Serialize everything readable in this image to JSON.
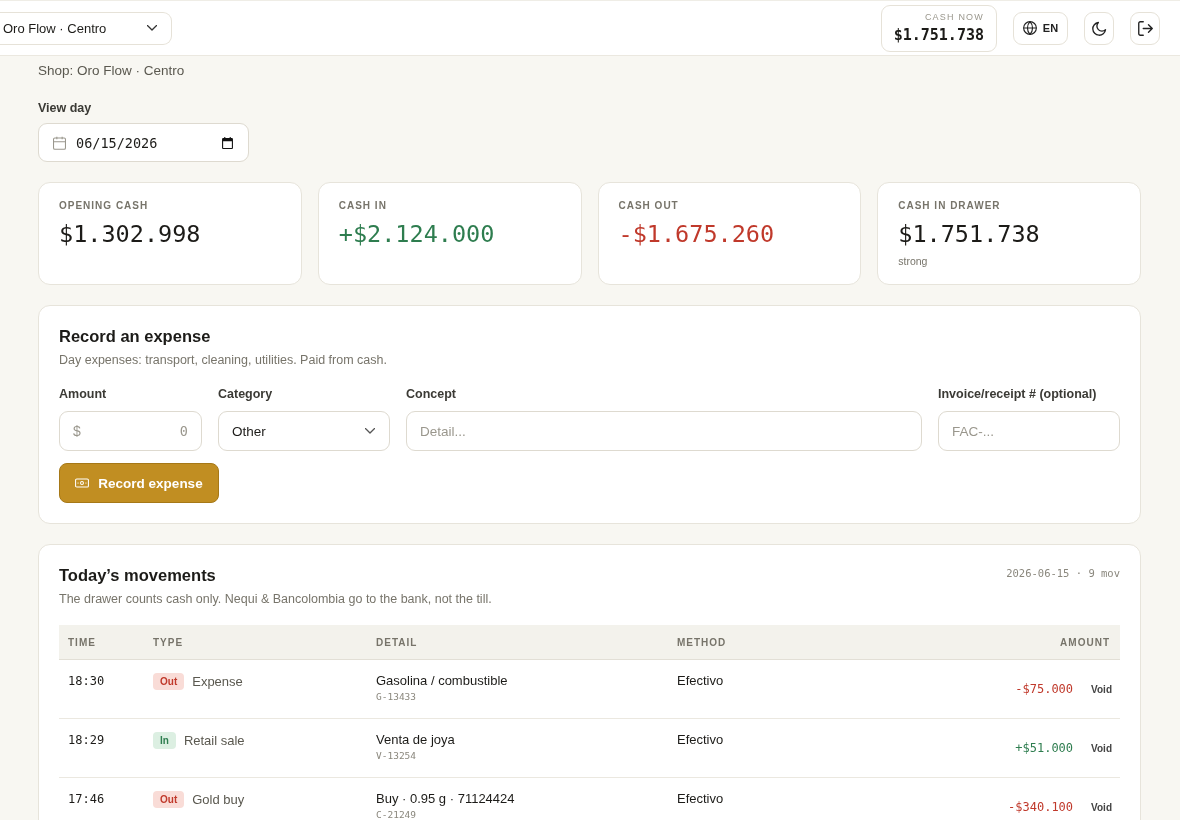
{
  "header": {
    "shop_select": {
      "value": "Oro Flow · Centro"
    },
    "cash_now": {
      "label": "CASH NOW",
      "value": "$1.751.738"
    },
    "language_button": {
      "label": "EN"
    }
  },
  "page": {
    "subtitle": "Shop: Oro Flow · Centro",
    "date_field": {
      "label": "View day",
      "value": "06/15/2026"
    }
  },
  "stats": [
    {
      "label": "OPENING CASH",
      "value": "$1.302.998",
      "kind": "neutral"
    },
    {
      "label": "CASH IN",
      "value": "+$2.124.000",
      "kind": "positive"
    },
    {
      "label": "CASH OUT",
      "value": "-$1.675.260",
      "kind": "negative"
    },
    {
      "label": "CASH IN DRAWER",
      "value": "$1.751.738",
      "kind": "neutral",
      "note": "strong"
    }
  ],
  "expense_form": {
    "title": "Record an expense",
    "description": "Day expenses: transport, cleaning, utilities. Paid from cash.",
    "fields": [
      {
        "kind": "amount",
        "label": "Amount",
        "prefix": "$",
        "placeholder": "0"
      },
      {
        "kind": "select",
        "label": "Category",
        "value": "Other"
      },
      {
        "kind": "text",
        "label": "Concept",
        "placeholder": "Detail..."
      },
      {
        "kind": "text",
        "label": "Invoice/receipt # (optional)",
        "placeholder": "FAC-..."
      }
    ],
    "submit_button": "Record expense"
  },
  "movements": {
    "title": "Today’s movements",
    "meta": "2026-06-15 · 9 mov",
    "description": "The drawer counts cash only. Nequi & Bancolombia go to the bank, not the till.",
    "table": {
      "columns": [
        "TIME",
        "TYPE",
        "DETAIL",
        "METHOD",
        "AMOUNT"
      ],
      "rows": [
        {
          "time": "18:30",
          "kind": "out",
          "badge": "Out",
          "type": "Expense",
          "detail": "Gasolina / combustible",
          "reference": "G-13433",
          "method": "Efectivo",
          "amount": "-$75.000",
          "action": "Void"
        },
        {
          "time": "18:29",
          "kind": "in",
          "badge": "In",
          "type": "Retail sale",
          "detail": "Venta de joya",
          "reference": "V-13254",
          "method": "Efectivo",
          "amount": "+$51.000",
          "action": "Void"
        },
        {
          "time": "17:46",
          "kind": "out",
          "badge": "Out",
          "type": "Gold buy",
          "detail": "Buy · 0.95 g · 71124424",
          "reference": "C-21249",
          "method": "Efectivo",
          "amount": "-$340.100",
          "action": "Void"
        }
      ]
    }
  }
}
